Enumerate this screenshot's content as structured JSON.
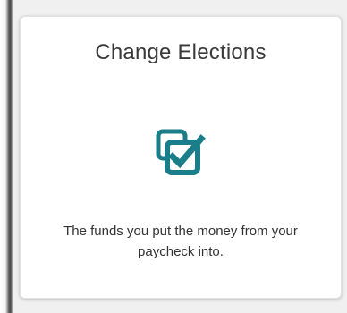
{
  "card": {
    "title": "Change Elections",
    "icon": "checkbox-copy-icon",
    "description": "The funds you put the money from your paycheck into.",
    "accent_color": "#1a7d8a"
  }
}
